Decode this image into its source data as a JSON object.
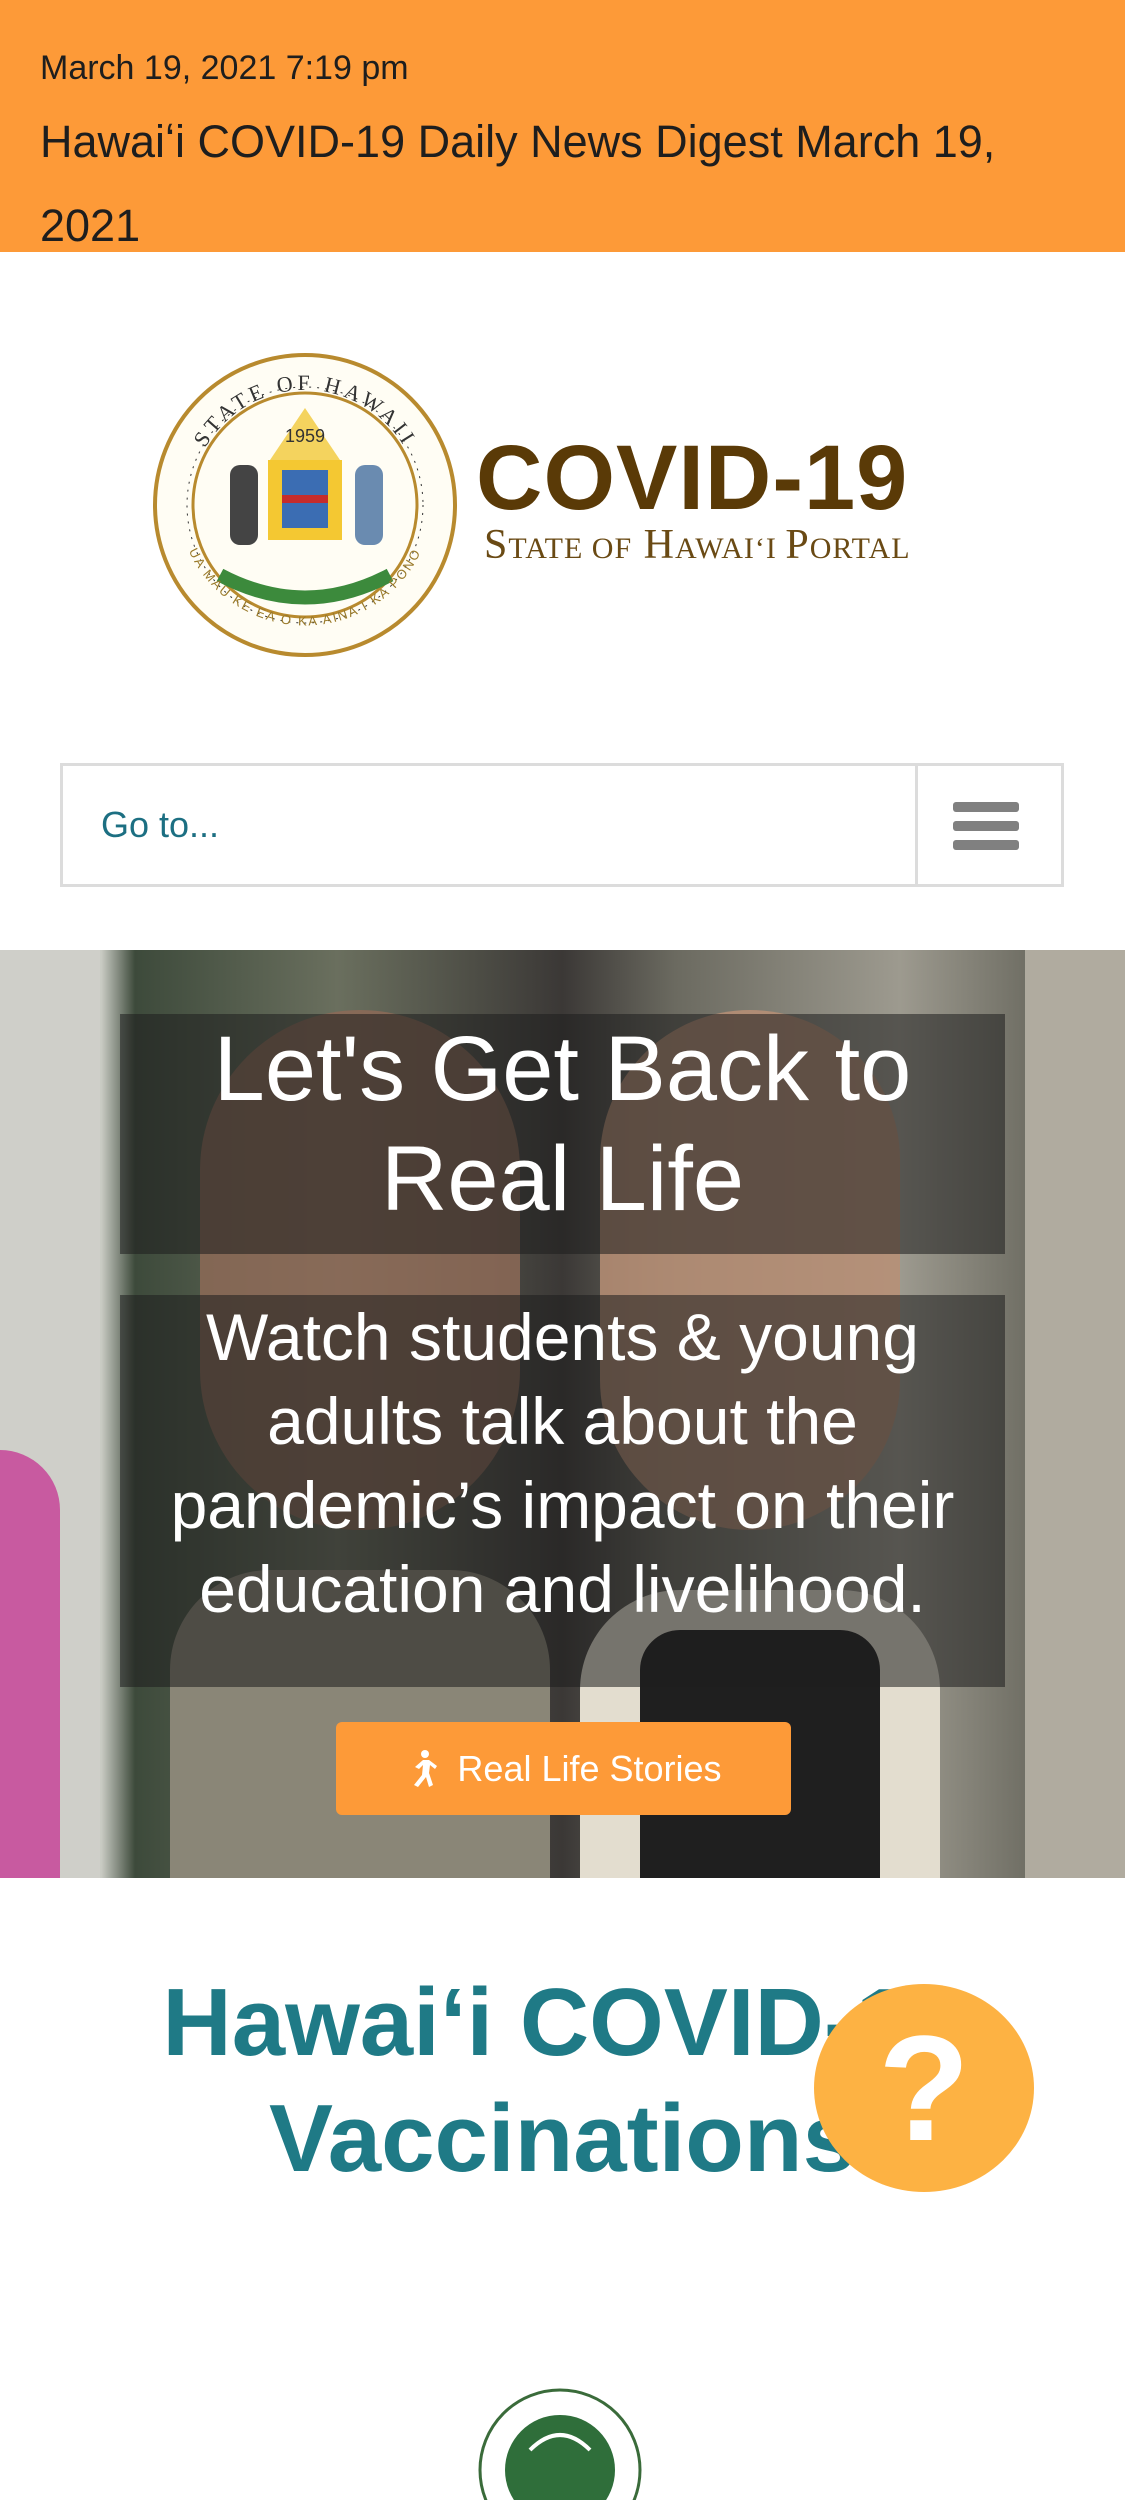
{
  "news": {
    "date": "March 19, 2021 7:19 pm",
    "title": "Hawaiʻi COVID-19 Daily News Digest March 19, 2021"
  },
  "logo": {
    "seal_text_top": "STATE OF HAWAII",
    "seal_year": "1959",
    "seal_text_bottom": "UA MAU KE EA O KA AINA I KA PONO",
    "title": "COVID-19",
    "subtitle_1": "S",
    "subtitle_2": "TATE ",
    "subtitle_3": "OF",
    "subtitle_4": " H",
    "subtitle_5": "AWAIʻI ",
    "subtitle_6": "P",
    "subtitle_7": "ORTAL"
  },
  "nav": {
    "select_label": "Go to...",
    "menu_icon": "hamburger-menu-icon"
  },
  "hero": {
    "title": "Let's Get Back to Real Life",
    "subtitle": "Watch students & young adults talk about the pandemic’s impact on their education and livelihood.",
    "cta_label": "Real Life Stories",
    "cta_icon": "running-person-icon"
  },
  "vaccination": {
    "title": "Hawaiʻi COVID-19 Vaccinations"
  },
  "help": {
    "label": "?"
  },
  "colors": {
    "news_bar": "#fd9a38",
    "brand_brown": "#5a3a07",
    "teal": "#1f7a86",
    "cta": "#fd9a38",
    "help": "#fdb243"
  }
}
